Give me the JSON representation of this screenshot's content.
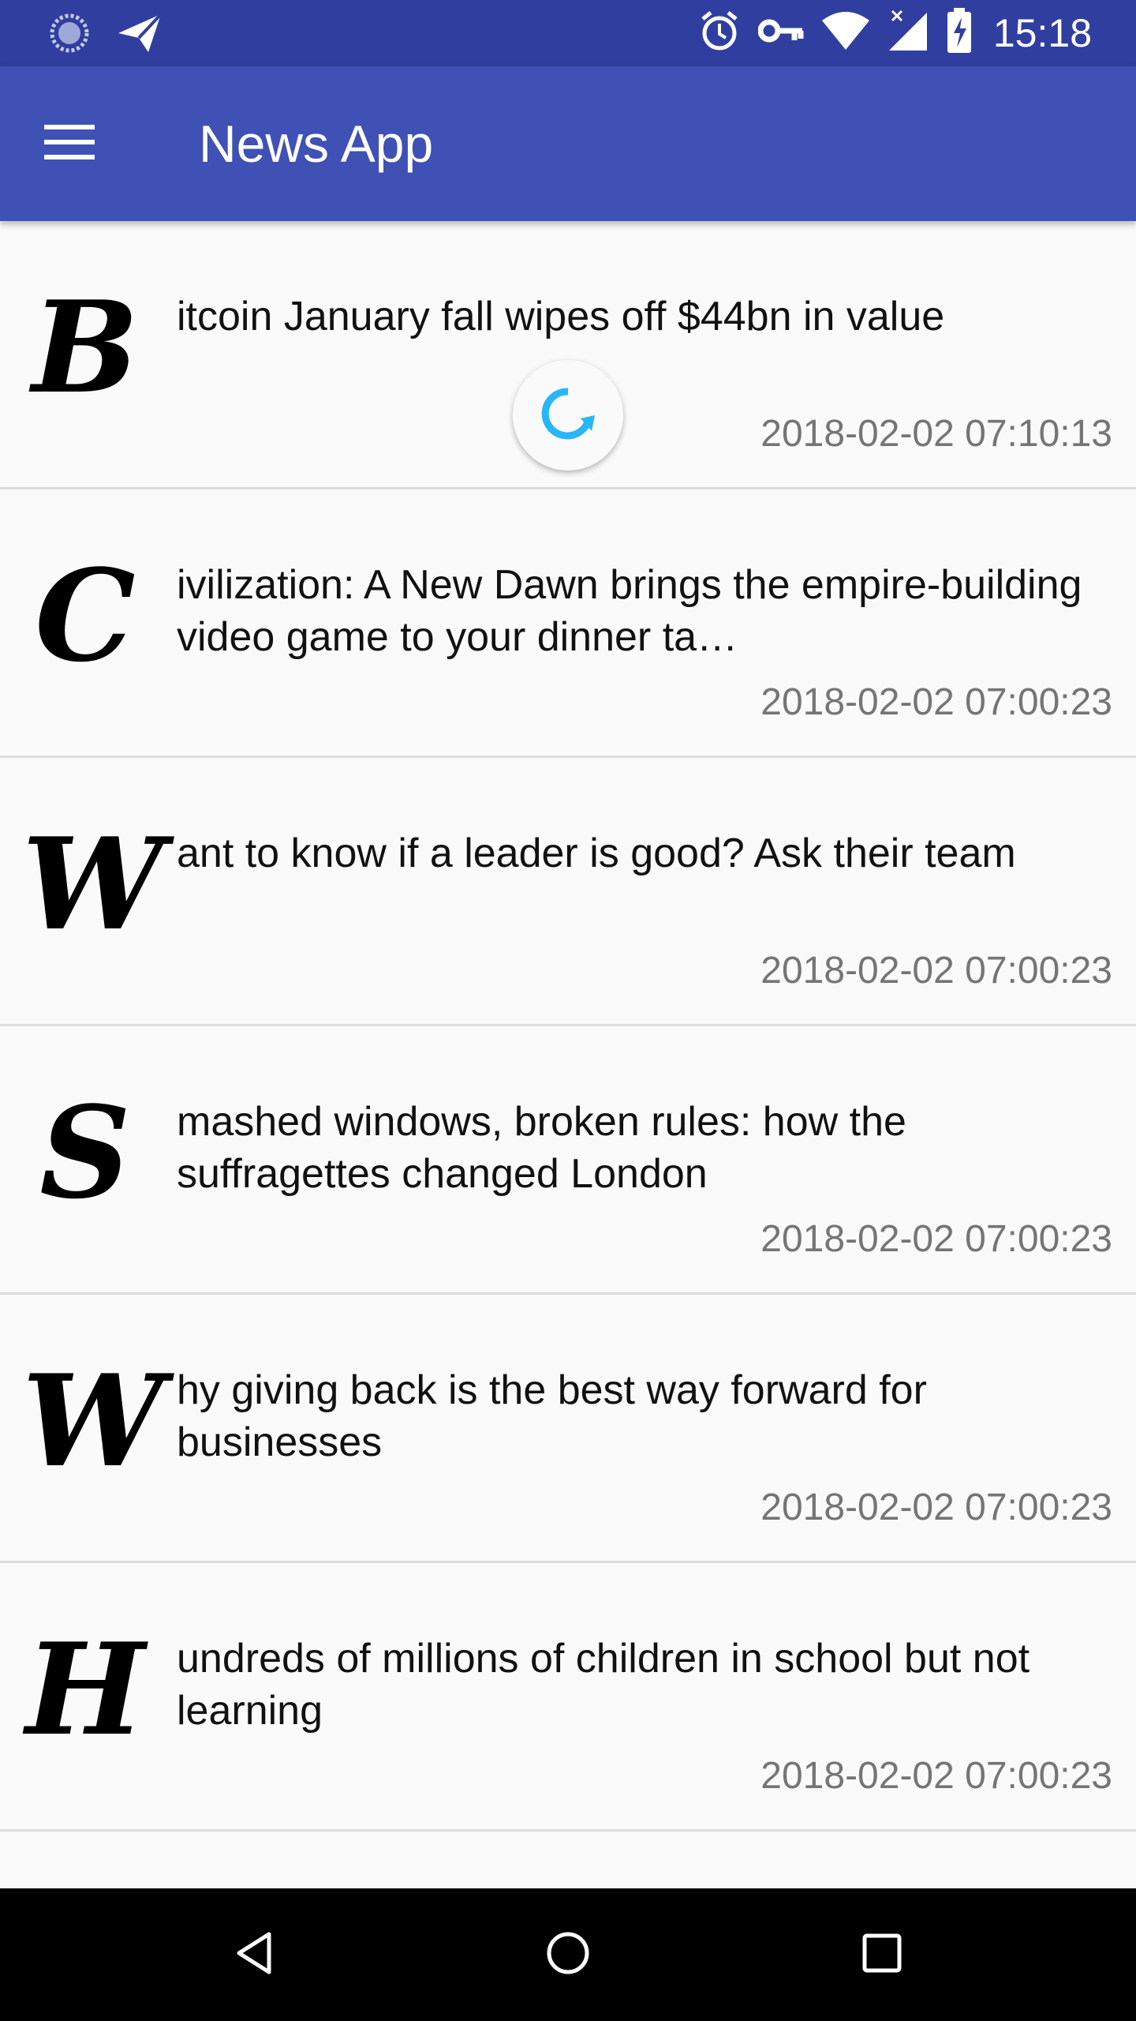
{
  "status_bar": {
    "time": "15:18",
    "icons": [
      "loading-circle-icon",
      "send-icon",
      "alarm-icon",
      "key-icon",
      "wifi-icon",
      "signal-icon",
      "battery-icon"
    ]
  },
  "app_bar": {
    "title": "News App",
    "menu_icon": "menu-icon"
  },
  "colors": {
    "status_bar": "#303f9f",
    "app_bar": "#3f51b5",
    "refresh_accent": "#29b6f6",
    "background": "#fafafa"
  },
  "news": [
    {
      "initial": "B",
      "title": "itcoin January fall wipes off $44bn in value",
      "date": "2018-02-02 07:10:13"
    },
    {
      "initial": "C",
      "title": "ivilization: A New Dawn brings the empire-building video game to your dinner ta…",
      "date": "2018-02-02 07:00:23"
    },
    {
      "initial": "W",
      "title": "ant to know if a leader is good? Ask their team",
      "date": "2018-02-02 07:00:23"
    },
    {
      "initial": "S",
      "title": "mashed windows, broken rules: how the suffragettes changed London",
      "date": "2018-02-02 07:00:23"
    },
    {
      "initial": "W",
      "title": "hy giving back is the best way forward for businesses",
      "date": "2018-02-02 07:00:23"
    },
    {
      "initial": "H",
      "title": "undreds of millions of children in school but not learning",
      "date": "2018-02-02 07:00:23"
    }
  ],
  "nav_bar": {
    "icons": [
      "back-icon",
      "home-icon",
      "recents-icon"
    ]
  }
}
